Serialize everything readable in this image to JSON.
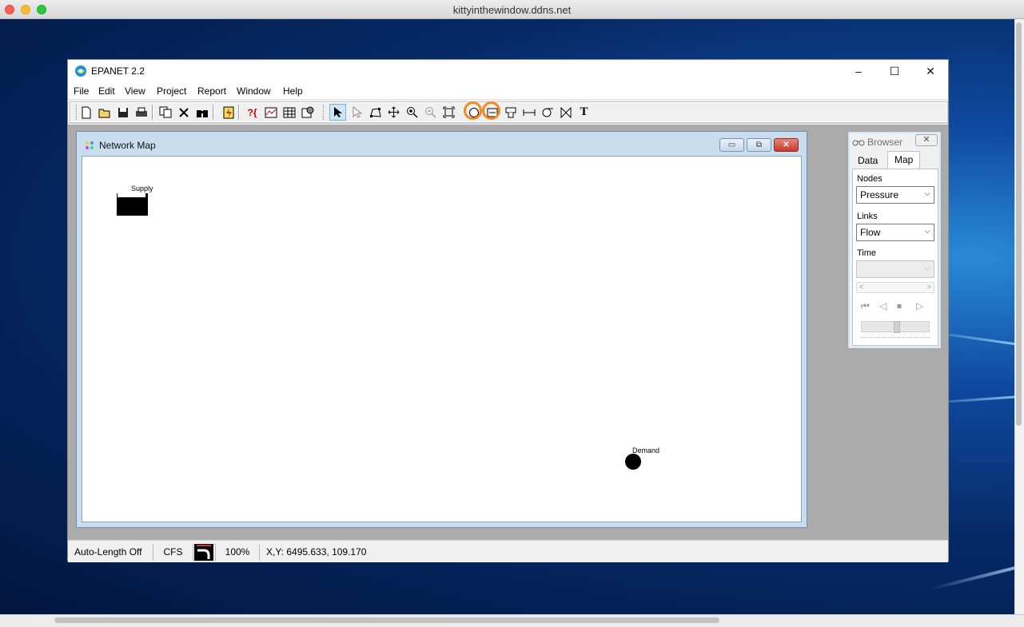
{
  "viewer": {
    "title": "kittyinthewindow.ddns.net"
  },
  "app": {
    "title": "EPANET 2.2",
    "window_controls": {
      "minimize": "–",
      "maximize": "☐",
      "close": "✕"
    },
    "menu": [
      "File",
      "Edit",
      "View",
      "Project",
      "Report",
      "Window",
      "Help"
    ],
    "toolbar": {
      "buttons": [
        {
          "name": "new-icon",
          "glyph": "🗋"
        },
        {
          "name": "open-icon",
          "glyph": "📂"
        },
        {
          "name": "save-icon",
          "glyph": "💾"
        },
        {
          "name": "print-icon",
          "glyph": "🖶"
        },
        {
          "name": "copy-icon",
          "glyph": "⎘"
        },
        {
          "name": "delete-icon",
          "glyph": "✕"
        },
        {
          "name": "find-icon",
          "glyph": "⚲"
        },
        {
          "name": "run-icon",
          "glyph": "⚡"
        },
        {
          "name": "query-icon",
          "glyph": "?{"
        },
        {
          "name": "graph-icon",
          "glyph": "▤"
        },
        {
          "name": "table-icon",
          "glyph": "▦"
        },
        {
          "name": "options-icon",
          "glyph": "⚙"
        },
        {
          "name": "select-object-icon",
          "glyph": "➤"
        },
        {
          "name": "select-vertex-icon",
          "glyph": "▷"
        },
        {
          "name": "select-region-icon",
          "glyph": "⬠"
        },
        {
          "name": "pan-icon",
          "glyph": "✥"
        },
        {
          "name": "zoom-in-icon",
          "glyph": "⊕"
        },
        {
          "name": "zoom-out-icon",
          "glyph": "⊖"
        },
        {
          "name": "full-extent-icon",
          "glyph": "⛶"
        },
        {
          "name": "add-junction-icon",
          "glyph": "○"
        },
        {
          "name": "add-reservoir-icon",
          "glyph": "⊟"
        },
        {
          "name": "add-tank-icon",
          "glyph": "⊓"
        },
        {
          "name": "add-pipe-icon",
          "glyph": "⟝"
        },
        {
          "name": "add-pump-icon",
          "glyph": "↻"
        },
        {
          "name": "add-valve-icon",
          "glyph": "⋈"
        },
        {
          "name": "add-label-icon",
          "glyph": "T"
        }
      ]
    },
    "network_map": {
      "title": "Network Map",
      "controls": {
        "minimize": "▭",
        "restore": "⧉",
        "close": "✕"
      },
      "nodes": [
        {
          "label": "Supply",
          "kind": "reservoir"
        },
        {
          "label": "Demand",
          "kind": "junction"
        }
      ]
    },
    "browser": {
      "title": "Browser",
      "close": "✕",
      "tabs": [
        "Data",
        "Map"
      ],
      "selected_tab": "Map",
      "nodes_label": "Nodes",
      "nodes_value": "Pressure",
      "links_label": "Links",
      "links_value": "Flow",
      "time_label": "Time",
      "time_value": "",
      "vcr": {
        "rewind": "⏮",
        "back": "◁",
        "stop": "⏹",
        "forward": "▷"
      }
    },
    "status": {
      "auto_length": "Auto-Length Off",
      "flow_units": "CFS",
      "zoom": "100%",
      "coords": "X,Y: 6495.633, 109.170"
    }
  },
  "colors": {
    "highlight_ring": "#f28a1f",
    "map_frame": "#c9ddef"
  }
}
